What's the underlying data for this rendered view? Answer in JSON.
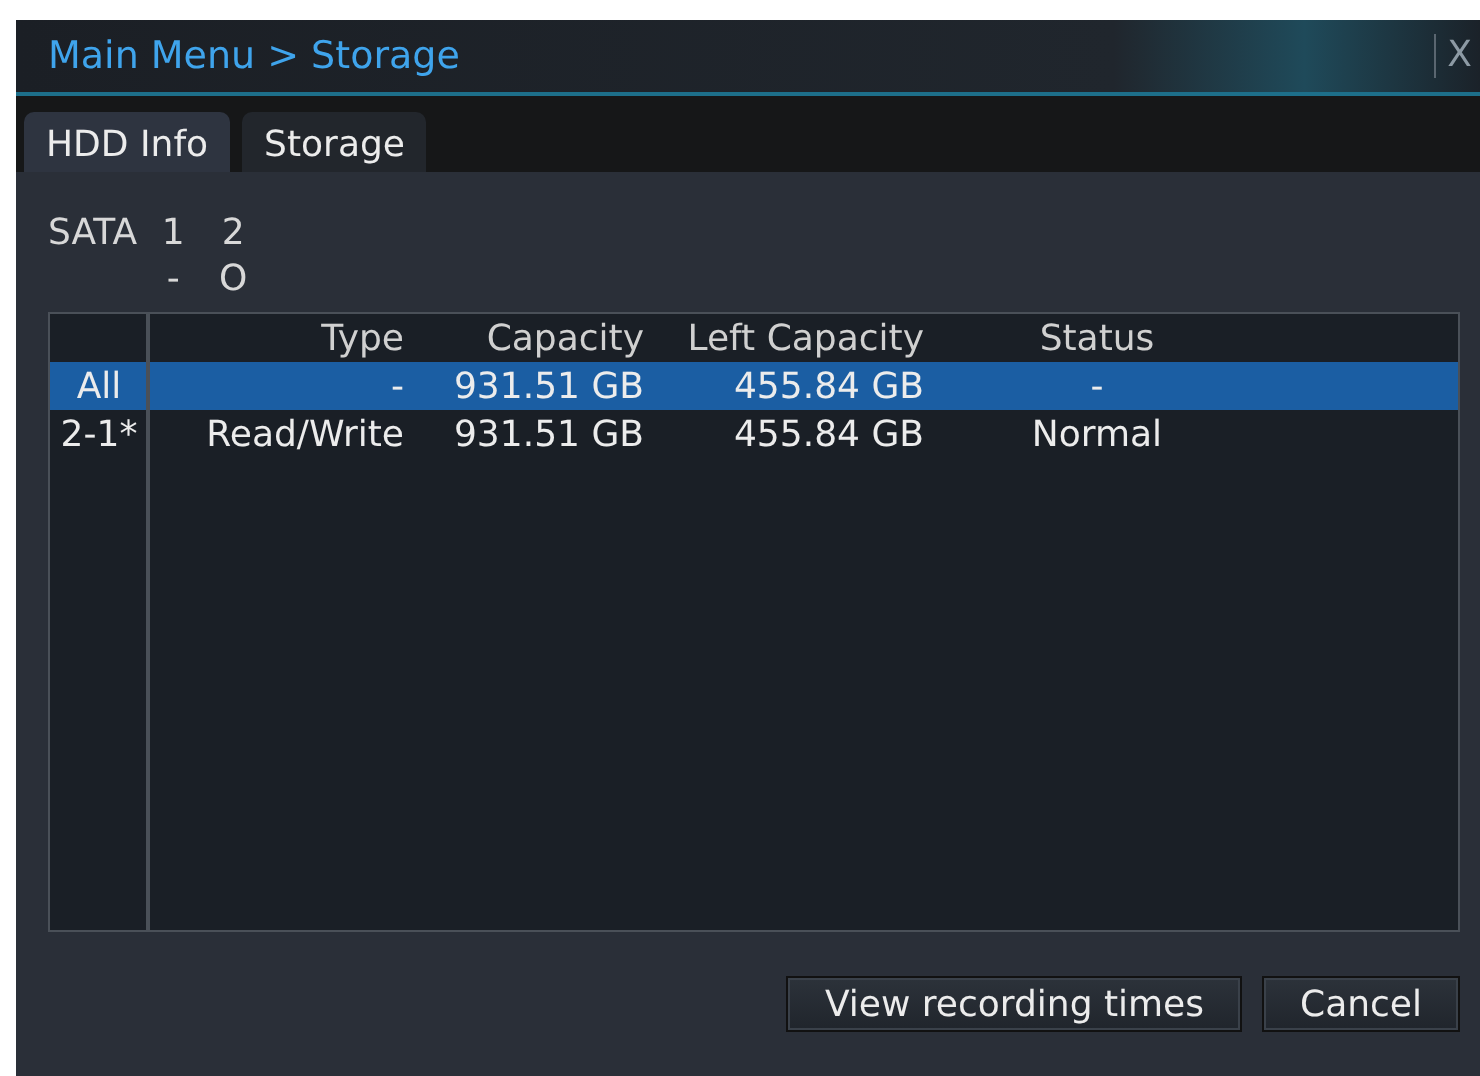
{
  "window": {
    "title": "Main Menu > Storage",
    "close": "X"
  },
  "tabs": [
    {
      "label": "HDD Info",
      "selected": true
    },
    {
      "label": "Storage",
      "selected": false
    }
  ],
  "sata": {
    "label": "SATA",
    "ports": [
      {
        "number": "1",
        "state": "-"
      },
      {
        "number": "2",
        "state": "O"
      }
    ]
  },
  "table": {
    "columns": [
      "Type",
      "Capacity",
      "Left Capacity",
      "Status"
    ],
    "rows": [
      {
        "index": "All",
        "selected": true,
        "cells": [
          "-",
          "931.51 GB",
          "455.84 GB",
          "-"
        ]
      },
      {
        "index": "2-1*",
        "selected": false,
        "cells": [
          "Read/Write",
          "931.51 GB",
          "455.84 GB",
          "Normal"
        ]
      }
    ]
  },
  "buttons": [
    "View recording times",
    "Cancel"
  ]
}
